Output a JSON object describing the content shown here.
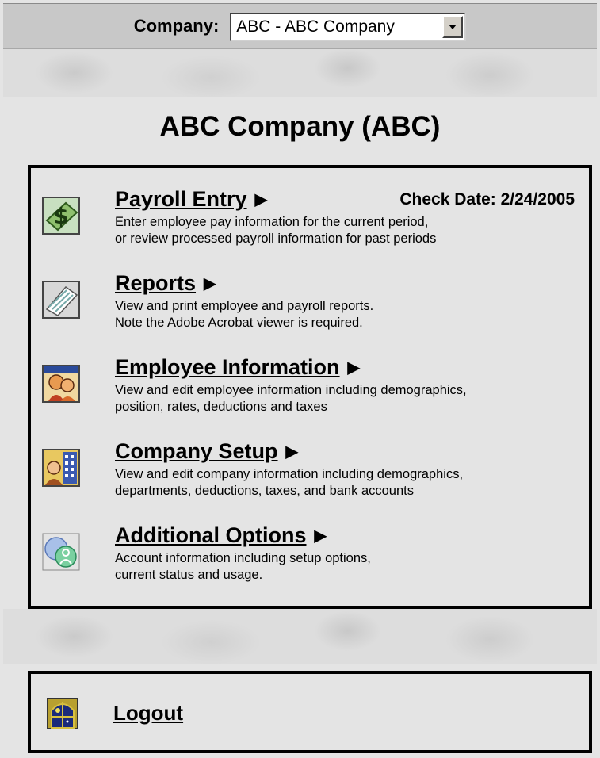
{
  "header": {
    "company_label": "Company:",
    "company_select_value": "ABC - ABC Company",
    "dropdown_icon": "chevron-down-icon"
  },
  "page_title": "ABC Company (ABC)",
  "menu": {
    "items": [
      {
        "title": "Payroll Entry",
        "icon": "payroll-money-icon",
        "desc_line1": "Enter employee pay information for the current period,",
        "desc_line2": "or review processed payroll information for past periods",
        "extra": "Check Date: 2/24/2005"
      },
      {
        "title": "Reports",
        "icon": "reports-papers-icon",
        "desc_line1": "View and print employee and payroll reports.",
        "desc_line2": "Note the Adobe Acrobat viewer is required."
      },
      {
        "title": "Employee Information",
        "icon": "employee-people-icon",
        "desc_line1": "View and edit employee information including demographics,",
        "desc_line2": "position, rates, deductions and taxes"
      },
      {
        "title": "Company Setup",
        "icon": "company-building-icon",
        "desc_line1": "View and edit company information including demographics,",
        "desc_line2": "departments, deductions, taxes, and bank accounts"
      },
      {
        "title": "Additional Options",
        "icon": "additional-options-icon",
        "desc_line1": "Account information including setup options,",
        "desc_line2": "current status and usage."
      }
    ]
  },
  "logout": {
    "label": "Logout",
    "icon": "logout-window-icon"
  }
}
